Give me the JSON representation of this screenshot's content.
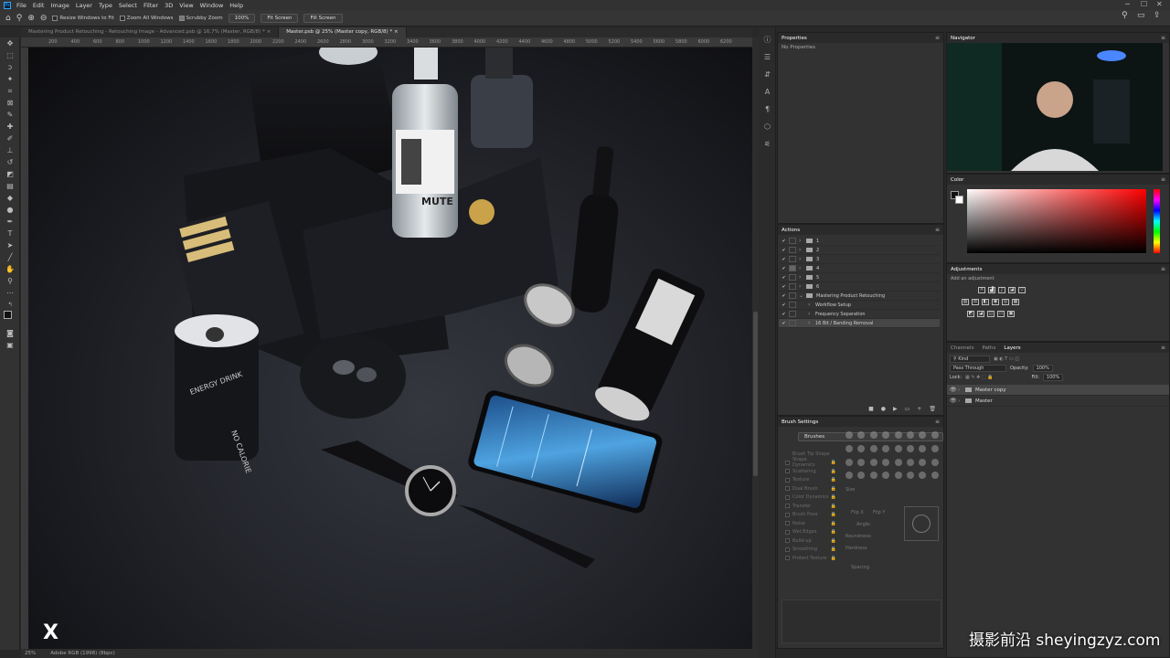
{
  "menu": [
    "File",
    "Edit",
    "Image",
    "Layer",
    "Type",
    "Select",
    "Filter",
    "3D",
    "View",
    "Window",
    "Help"
  ],
  "options": {
    "resize_windows": "Resize Windows to Fit",
    "zoom_all": "Zoom All Windows",
    "scrubby_zoom": "Scrubby Zoom",
    "zoom_value": "100%",
    "fit_screen": "Fit Screen",
    "fill_screen": "Fill Screen"
  },
  "tabs": [
    {
      "label": "Mastering Product Retouching - Retouching Image - Advanced.psb @ 16,7% (Master, RGB/8) *",
      "active": false
    },
    {
      "label": "Master.psb @ 25% (Master copy, RGB/8) *",
      "active": true
    }
  ],
  "ruler": [
    "200",
    "400",
    "600",
    "800",
    "1000",
    "1200",
    "1400",
    "1600",
    "1800",
    "2000",
    "2200",
    "2400",
    "2600",
    "2800",
    "3000",
    "3200",
    "3400",
    "3600",
    "3800",
    "4000",
    "4200",
    "4400",
    "4600",
    "4800",
    "5000",
    "5200",
    "5400",
    "5600",
    "5800",
    "6000",
    "6200"
  ],
  "status": {
    "zoom": "25%",
    "profile": "Adobe RGB (1998) (8bpc)"
  },
  "properties": {
    "title": "Properties",
    "empty": "No Properties"
  },
  "actions": {
    "title": "Actions",
    "items": [
      "1",
      "2",
      "3",
      "4",
      "5",
      "6",
      "Mastering Product Retouching",
      "Workflow Setup",
      "Frequency Separation",
      "16 Bit / Banding Removal"
    ]
  },
  "brush_settings": {
    "title": "Brush Settings",
    "brushes_button": "Brushes",
    "items": [
      "Brush Tip Shape",
      "Shape Dynamics",
      "Scattering",
      "Texture",
      "Dual Brush",
      "Color Dynamics",
      "Transfer",
      "Brush Pose",
      "Noise",
      "Wet Edges",
      "Build-up",
      "Smoothing",
      "Protect Texture"
    ],
    "size": "Size",
    "flip_x": "Flip X",
    "flip_y": "Flip Y",
    "angle": "Angle:",
    "roundness": "Roundness:",
    "hardness": "Hardness",
    "spacing": "Spacing"
  },
  "navigator": {
    "title": "Navigator"
  },
  "color": {
    "title": "Color",
    "fg": "#111111",
    "bg": "#ffffff"
  },
  "adjustments": {
    "title": "Adjustments",
    "hint": "Add an adjustment"
  },
  "layers_panel": {
    "tabs": [
      "Channels",
      "Paths",
      "Layers"
    ],
    "kind": "Kind",
    "blend": "Pass Through",
    "opacity_label": "Opacity:",
    "opacity": "100%",
    "lock_label": "Lock:",
    "fill_label": "Fill:",
    "fill": "100%",
    "layers": [
      {
        "name": "Master copy",
        "selected": true
      },
      {
        "name": "Master",
        "selected": false
      }
    ]
  },
  "phone_texts": [
    "NO CALORIE",
    "ENERGY DRINK",
    "MUTE"
  ],
  "overlay": {
    "logo": "X",
    "watermark": "摄影前沿 sheyingzyz.com"
  }
}
